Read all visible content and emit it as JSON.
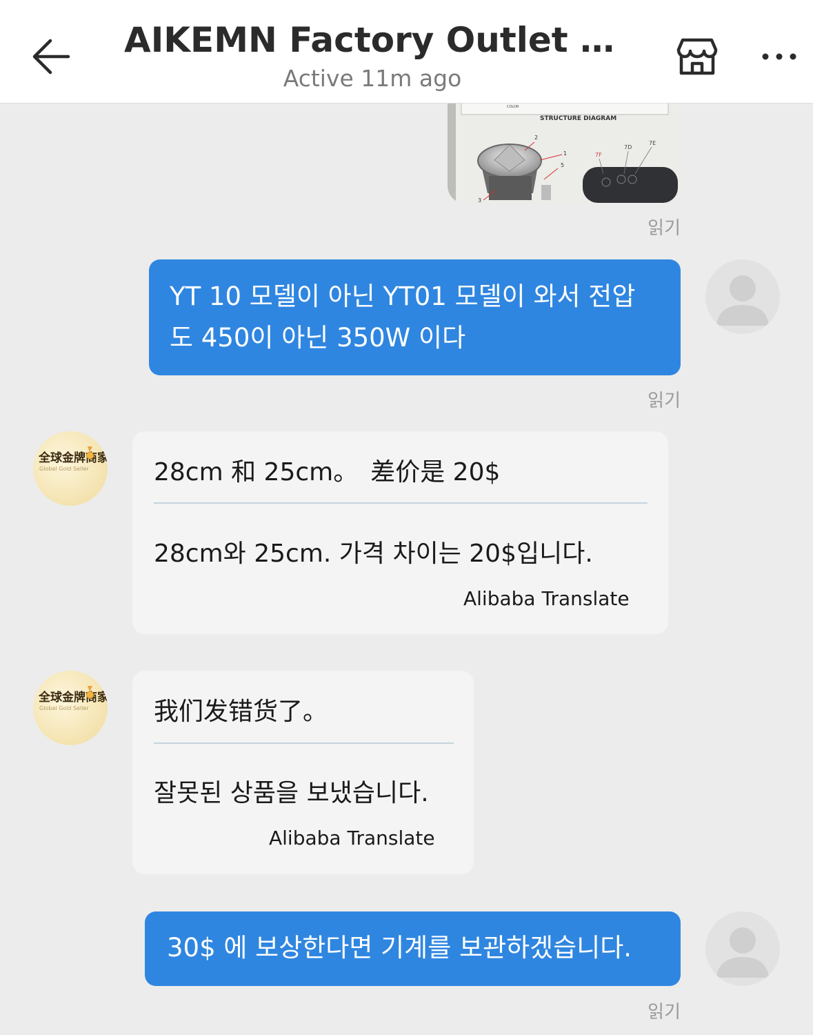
{
  "header": {
    "title": "AIKEMN Factory Outlet St...",
    "status": "Active 11m ago"
  },
  "image_message": {
    "caption": "STRUCTURE DIAGRAM",
    "label_top": "COLOR",
    "callouts": [
      "2",
      "1",
      "5",
      "3"
    ],
    "panel_labels": [
      "7F",
      "7D",
      "7E"
    ]
  },
  "messages": [
    {
      "read": "읽기"
    },
    {
      "text_line1": "YT 10 모델이 아닌 YT01 모델이 와서 전압",
      "text_line2": "도 450이 아닌 350W 이다",
      "read": "읽기"
    },
    {
      "seller_name": "全球金牌商家",
      "seller_sub": "Global Gold Seller",
      "original": "28cm 和 25cm。　差价是 20$",
      "translated": "28cm와 25cm.   가격 차이는 20$입니다.",
      "source": "Alibaba Translate"
    },
    {
      "seller_name": "全球金牌商家",
      "seller_sub": "Global Gold Seller",
      "original": "我们发错货了。",
      "translated": "잘못된 상품을 보냈습니다.",
      "source": "Alibaba Translate"
    },
    {
      "text": "30$ 에 보상한다면 기계를 보관하겠습니다.",
      "read": "읽기"
    }
  ],
  "icons": {
    "back": "arrow-left-icon",
    "store": "store-icon",
    "more": "more-horizontal-icon",
    "user_avatar": "user-silhouette-icon",
    "medal": "medal-icon"
  },
  "colors": {
    "outgoing_bubble": "#2f86e0",
    "incoming_bubble": "#f4f4f4",
    "background": "#ececec",
    "read_label": "#9a9a9a"
  }
}
